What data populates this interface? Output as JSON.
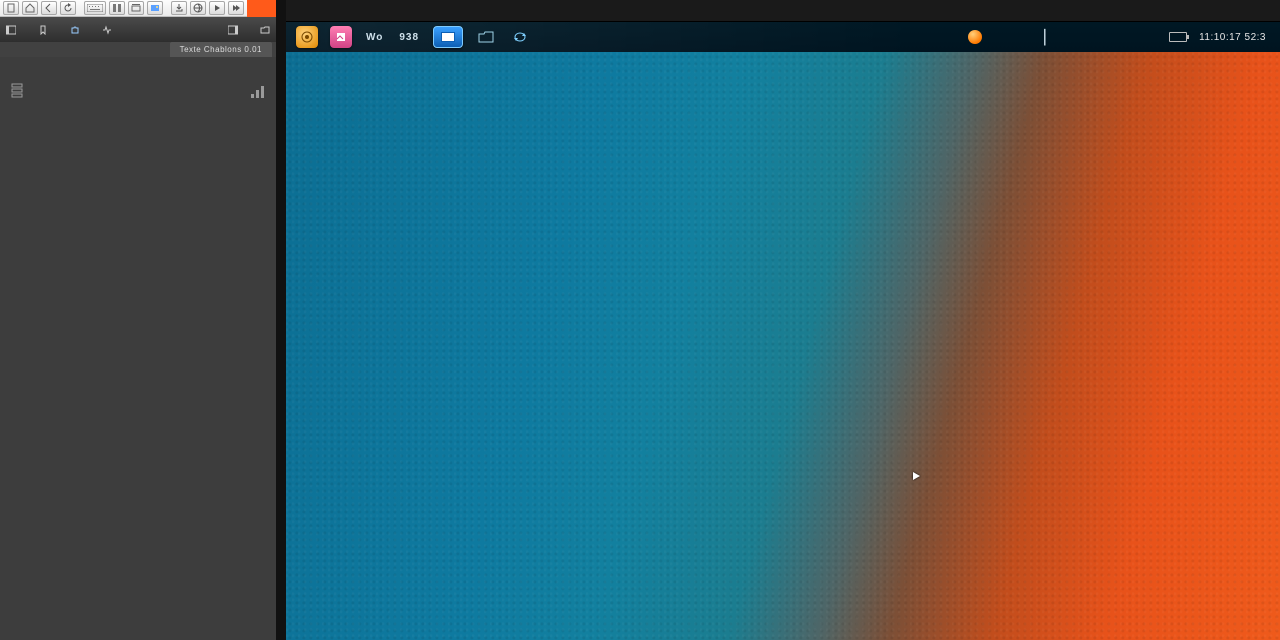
{
  "left_app": {
    "toolbar_icons": [
      "file-icon",
      "home-icon",
      "back-icon",
      "reload-icon",
      "keyboard-icon",
      "columns-icon",
      "gallery-icon",
      "photo-icon",
      "export-icon",
      "globe-icon",
      "play-icon",
      "play-all-icon",
      "stop-icon"
    ],
    "accent_indicator": "accent-tab",
    "tabbar_icons_left": [
      "panel-left-icon",
      "bookmark-icon",
      "puzzle-icon",
      "activity-icon"
    ],
    "tabbar_icons_right": [
      "panel-right-icon",
      "folder-open-icon"
    ],
    "document_tab_label": "Texte Chablons 0.01",
    "dock_left_icon": "structure-icon",
    "dock_right_icon": "levels-icon"
  },
  "right_app": {
    "taskbar": {
      "launcher": "launcher",
      "image_viewer": "image-viewer",
      "text_label_1": "Wo",
      "text_label_2": "938",
      "display_settings": "display-settings",
      "file_manager": "file-manager",
      "sync": "sync",
      "status_dot": "notification-dot",
      "clock": "11:10:17 52:3"
    },
    "wallpaper": "teal-orange-texture"
  },
  "colors": {
    "accent_orange": "#ff5a1a",
    "panel_dark": "#3d3d3d"
  }
}
